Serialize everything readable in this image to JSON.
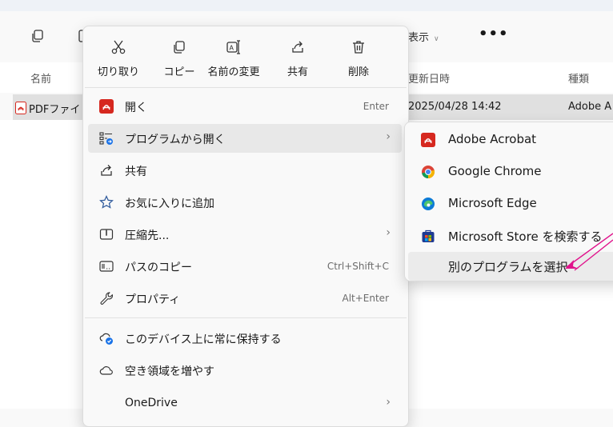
{
  "explorer": {
    "view_label": "表示",
    "more_label": "•••",
    "columns": {
      "name": "名前",
      "modified": "更新日時",
      "type": "種類"
    },
    "file": {
      "name": "PDFファイ",
      "modified": "2025/04/28 14:42",
      "type": "Adobe A"
    }
  },
  "context_menu": {
    "quick_actions": [
      {
        "label": "切り取り",
        "icon": "cut-icon"
      },
      {
        "label": "コピー",
        "icon": "copy-icon"
      },
      {
        "label": "名前の変更",
        "icon": "rename-icon"
      },
      {
        "label": "共有",
        "icon": "share-icon"
      },
      {
        "label": "削除",
        "icon": "delete-icon"
      }
    ],
    "items": [
      {
        "label": "開く",
        "accelerator": "Enter",
        "icon": "pdf-icon"
      },
      {
        "label": "プログラムから開く",
        "accelerator": "",
        "icon": "open-with-icon",
        "submenu": true
      },
      {
        "label": "共有",
        "accelerator": "",
        "icon": "share-icon"
      },
      {
        "label": "お気に入りに追加",
        "accelerator": "",
        "icon": "star-icon"
      },
      {
        "label": "圧縮先...",
        "accelerator": "",
        "icon": "zip-icon",
        "submenu": true
      },
      {
        "label": "パスのコピー",
        "accelerator": "Ctrl+Shift+C",
        "icon": "copy-path-icon"
      },
      {
        "label": "プロパティ",
        "accelerator": "Alt+Enter",
        "icon": "wrench-icon"
      },
      {
        "label": "このデバイス上に常に保持する",
        "accelerator": "",
        "icon": "cloud-sync-icon"
      },
      {
        "label": "空き領域を増やす",
        "accelerator": "",
        "icon": "cloud-icon"
      },
      {
        "label": "OneDrive",
        "accelerator": "",
        "icon": "",
        "submenu": true
      }
    ]
  },
  "open_with_submenu": {
    "items": [
      {
        "label": "Adobe Acrobat",
        "icon": "acrobat-icon"
      },
      {
        "label": "Google Chrome",
        "icon": "chrome-icon"
      },
      {
        "label": "Microsoft Edge",
        "icon": "edge-icon"
      },
      {
        "label": "Microsoft Store を検索する",
        "icon": "store-icon"
      },
      {
        "label": "別のプログラムを選択",
        "icon": ""
      }
    ]
  },
  "colors": {
    "acrobat_red": "#d6281f",
    "annotation_magenta": "#e0138c",
    "highlight": "#e8e8e8"
  }
}
